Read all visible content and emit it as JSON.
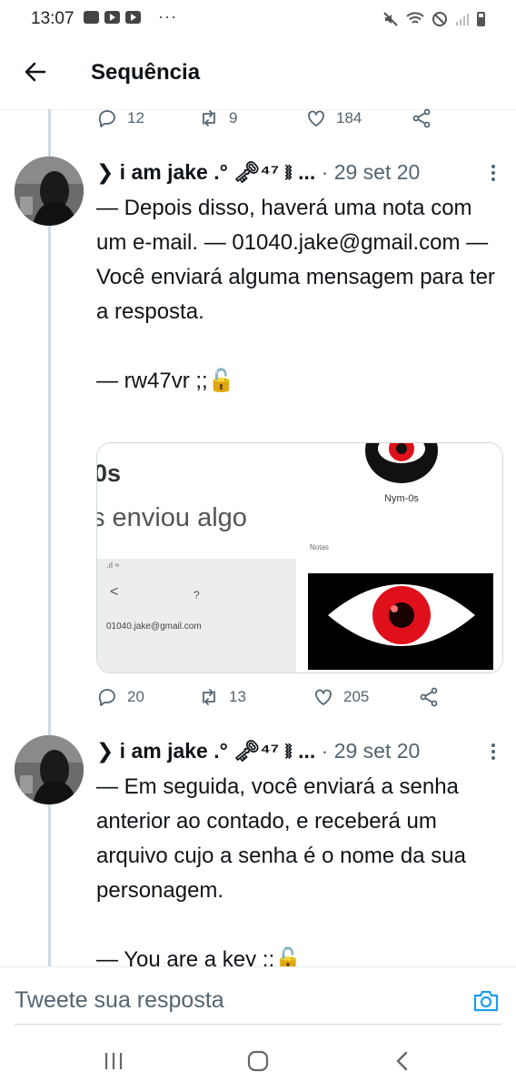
{
  "status_bar": {
    "time": "13:07",
    "dots": "···"
  },
  "header": {
    "title": "Sequência"
  },
  "prev_actions": {
    "reply": "12",
    "retweet": "9",
    "like": "184"
  },
  "tweets": [
    {
      "name": "❯ i am jake .° 🗝⁴⁷ ⧚ ...",
      "date": " · 29 set 20",
      "text": "— Depois disso, haverá uma nota com um e-mail. — 01040.jake@gmail.com — Você enviará alguma mensagem para ter a resposta.\n\n— rw47vr ;;🔓",
      "media": {
        "cell1_line1": "0s",
        "cell1_line2": "s enviou algo",
        "cell2_caption": "Nym-0s",
        "cell2_footer": "Notas",
        "cell3_back": "<",
        "cell3_question": "?",
        "cell3_email": "01040.jake@gmail.com"
      },
      "actions": {
        "reply": "20",
        "retweet": "13",
        "like": "205"
      }
    },
    {
      "name": "❯ i am jake .° 🗝⁴⁷ ⧚ ...",
      "date": " · 29 set 20",
      "text": "— Em seguida, você enviará a senha anterior ao contado, e receberá um arquivo cujo a senha é o nome da sua personagem.\n\n— You are a key ;;🔓"
    }
  ],
  "composer": {
    "placeholder": "Tweete sua resposta"
  },
  "colors": {
    "accent": "#1d9bf0",
    "secondary_text": "#536471",
    "eye_red": "#e0101a"
  }
}
